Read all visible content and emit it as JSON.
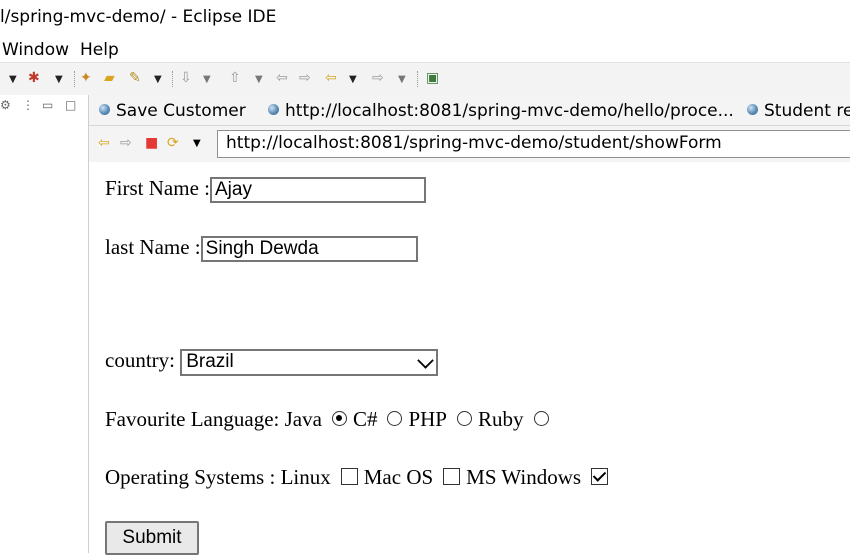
{
  "window": {
    "title": "l/spring-mvc-demo/ - Eclipse IDE"
  },
  "menu": {
    "items": [
      "Window",
      "Help"
    ]
  },
  "toolbar": {
    "icons": [
      "chevron-down-icon",
      "debug-icon",
      "chevron-down-icon",
      "open-type-icon",
      "open-folder-icon",
      "pin-icon",
      "chevron-down-icon",
      "next-annotation-icon",
      "chevron-down-icon",
      "prev-annotation-icon",
      "chevron-down-icon",
      "back-gray-icon",
      "forward-gray-icon",
      "back-icon",
      "chevron-down-icon",
      "forward-icon",
      "chevron-down-icon",
      "open-console-icon"
    ]
  },
  "tabs": [
    {
      "label": "Save Customer"
    },
    {
      "label": "http://localhost:8081/spring-mvc-demo/hello/proce..."
    },
    {
      "label": "Student reg"
    }
  ],
  "browser": {
    "url": "http://localhost:8081/spring-mvc-demo/student/showForm"
  },
  "form": {
    "first_name_label": "First Name :",
    "first_name_value": "Ajay",
    "last_name_label": "last Name :",
    "last_name_value": "Singh Dewda",
    "country_label": "country:",
    "country_value": "Brazil",
    "language_label": "Favourite Language:",
    "languages": [
      {
        "label": "Java",
        "checked": true
      },
      {
        "label": "C#",
        "checked": false
      },
      {
        "label": "PHP",
        "checked": false
      },
      {
        "label": "Ruby",
        "checked": false
      }
    ],
    "os_label": "Operating Systems :",
    "systems": [
      {
        "label": "Linux",
        "checked": false
      },
      {
        "label": "Mac OS",
        "checked": false
      },
      {
        "label": "MS Windows",
        "checked": true
      }
    ],
    "submit_label": "Submit"
  }
}
